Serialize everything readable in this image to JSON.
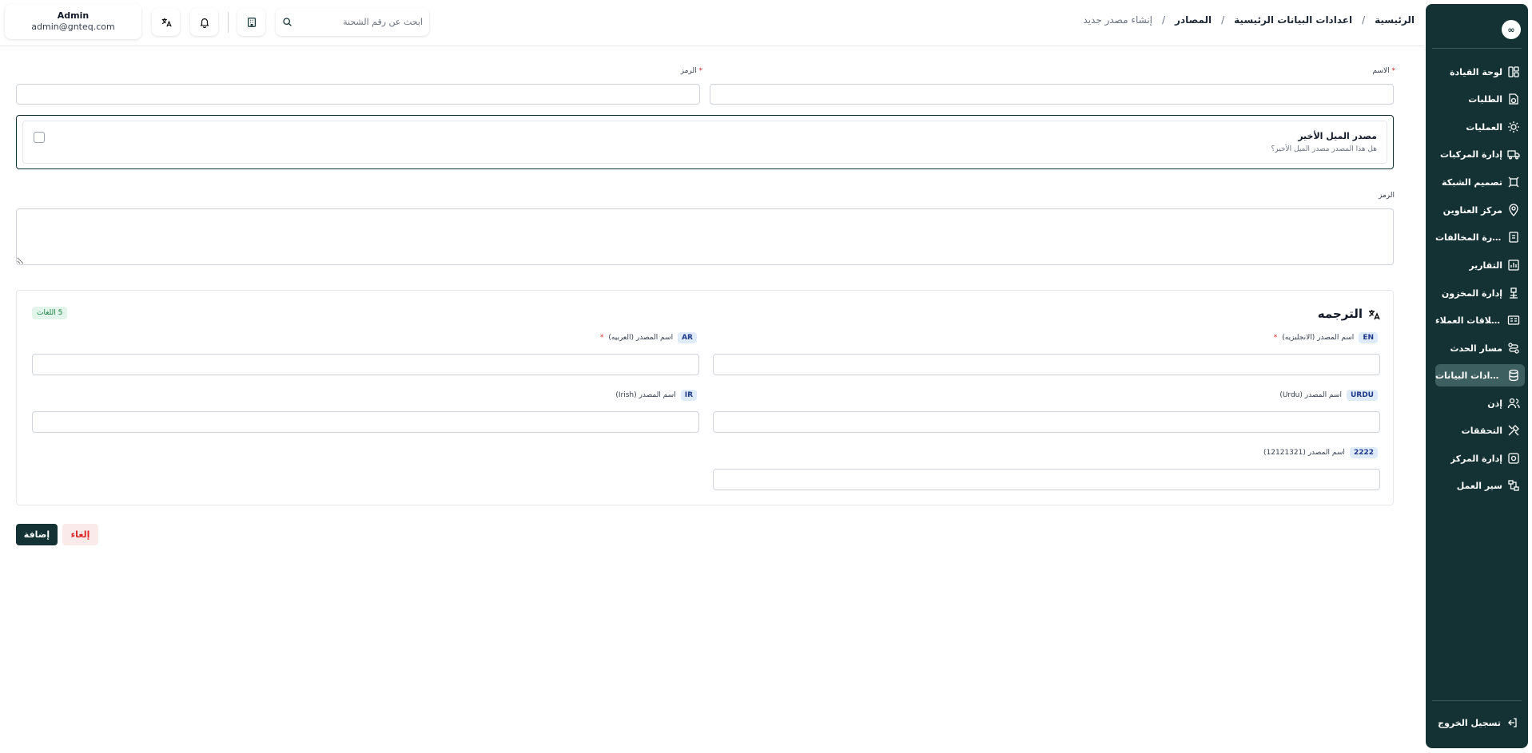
{
  "breadcrumb": {
    "items": [
      "الرئيسية",
      "اعدادات البيانات الرئيسية",
      "المصادر",
      "إنشاء مصدر جديد"
    ],
    "separator": "/"
  },
  "search": {
    "placeholder": "ابحث عن رقم الشحنة",
    "icon": "search-icon"
  },
  "user": {
    "name": "Admin",
    "email": "admin@gnteq.com"
  },
  "header_icons": [
    "translate-icon",
    "bell-icon",
    "building-icon"
  ],
  "sidebar": {
    "logo": "∞",
    "items": [
      {
        "label": "لوحة القيادة",
        "icon": "dashboard-icon"
      },
      {
        "label": "الطلبات",
        "icon": "orders-icon"
      },
      {
        "label": "العمليات",
        "icon": "operations-icon"
      },
      {
        "label": "إدارة المركبات",
        "icon": "truck-icon"
      },
      {
        "label": "تصميم الشبكة",
        "icon": "network-icon"
      },
      {
        "label": "مركز العناوين",
        "icon": "location-icon"
      },
      {
        "label": "إدارة المخالفات",
        "icon": "violations-icon"
      },
      {
        "label": "التقارير",
        "icon": "reports-icon"
      },
      {
        "label": "إدارة المخزون",
        "icon": "inventory-icon"
      },
      {
        "label": "إدارة علاقات العملاء",
        "icon": "crm-icon"
      },
      {
        "label": "مسار الحدث",
        "icon": "route-icon"
      },
      {
        "label": "اعدادات البيانات...",
        "icon": "database-icon",
        "active": true
      },
      {
        "label": "إذن",
        "icon": "users-icon"
      },
      {
        "label": "التحققات",
        "icon": "tools-icon"
      },
      {
        "label": "إدارة المركز",
        "icon": "center-icon"
      },
      {
        "label": "سير العمل",
        "icon": "workflow-icon"
      }
    ],
    "logout": "تسجيل الخروج"
  },
  "form": {
    "name_label": "الاسم",
    "code_label": "الرمز",
    "required_mark": "*",
    "last_mile": {
      "title": "مصدر الميل الأخير",
      "description": "هل هذا المصدر مصدر الميل الأخير؟",
      "checked": false
    },
    "textarea_label": "الرمز"
  },
  "translation": {
    "title": "الترجمه",
    "count_label": "5 اللغات",
    "fields": [
      {
        "badge": "EN",
        "label": "اسم المصدر (الانجليزيه)",
        "required": true
      },
      {
        "badge": "AR",
        "label": "اسم المصدر (العربيه)",
        "required": true
      },
      {
        "badge": "URDU",
        "label": "اسم المصدر (Urdu)",
        "required": false
      },
      {
        "badge": "IR",
        "label": "اسم المصدر (Irish)",
        "required": false
      },
      {
        "badge": "2222",
        "label": "اسم المصدر (12121321)",
        "required": false
      }
    ]
  },
  "actions": {
    "add_label": "إضافة",
    "cancel_label": "إلغاء"
  },
  "colors": {
    "primary": "#143234",
    "danger": "#dc2626",
    "success_bg": "#e3f4ea",
    "badge_bg": "#e0ebfa"
  }
}
